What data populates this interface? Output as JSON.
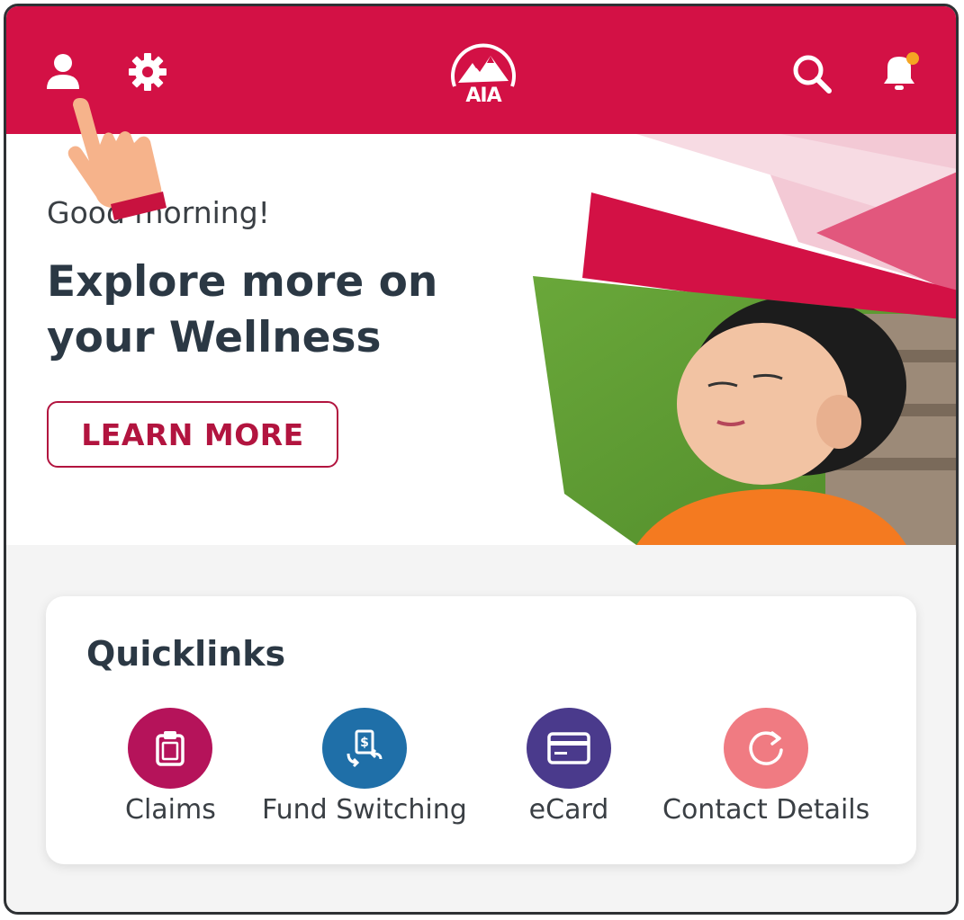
{
  "header": {
    "logo_text": "AIA",
    "icons": [
      "profile-icon",
      "settings-icon",
      "search-icon",
      "notification-bell-icon"
    ],
    "brand_color": "#d31145",
    "notification_dot_color": "#f5a623"
  },
  "hero": {
    "greeting": "Good morning!",
    "headline": "Explore more on your Wellness",
    "cta_label": "LEARN MORE"
  },
  "quicklinks": {
    "title": "Quicklinks",
    "items": [
      {
        "label": "Claims",
        "icon": "clipboard-icon",
        "color": "#b5135a"
      },
      {
        "label": "Fund Switching",
        "icon": "fund-switch-icon",
        "color": "#1f6fa8"
      },
      {
        "label": "eCard",
        "icon": "card-icon",
        "color": "#4a3a8c"
      },
      {
        "label": "Contact Details",
        "icon": "refresh-icon",
        "color": "#f07b82"
      }
    ]
  }
}
